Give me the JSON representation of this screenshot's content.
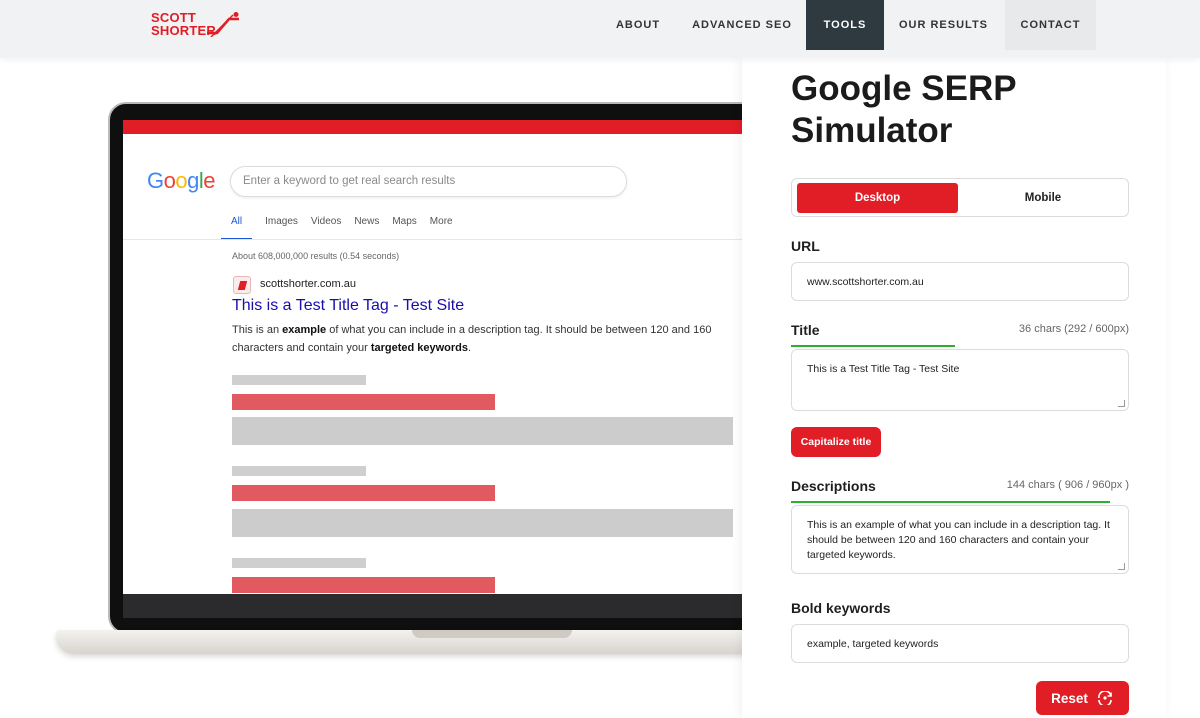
{
  "brand": {
    "line1": "SCOTT",
    "line2": "SHORTER",
    "color": "#e11d26"
  },
  "nav": [
    {
      "label": "ABOUT"
    },
    {
      "label": "ADVANCED SEO"
    },
    {
      "label": "TOOLS",
      "active": true
    },
    {
      "label": "OUR RESULTS"
    },
    {
      "label": "CONTACT"
    }
  ],
  "preview": {
    "search_placeholder": "Enter a keyword to get real search results",
    "tabs": [
      "All",
      "Images",
      "Videos",
      "News",
      "Maps",
      "More"
    ],
    "active_tab": "All",
    "stats": "About 608,000,000 results (0.54 seconds)",
    "site": "scottshorter.com.au",
    "title": "This is a Test Title Tag - Test Site",
    "description_parts": {
      "p1": "This is an ",
      "b1": "example",
      "p2": " of what you can include in a description tag. It should be between 120 and 160 characters and contain your ",
      "b2": "targeted keywords",
      "p3": "."
    }
  },
  "panel": {
    "title_line1": "Google SERP",
    "title_line2": "Simulator",
    "toggle": {
      "desktop": "Desktop",
      "mobile": "Mobile",
      "selected": "Desktop"
    },
    "url": {
      "label": "URL",
      "value": "www.scottshorter.com.au"
    },
    "title": {
      "label": "Title",
      "meta": "36 chars (292 / 600px)",
      "value": "This is a Test Title Tag - Test Site",
      "fill": 0.49
    },
    "capitalize_label": "Capitalize title",
    "descriptions": {
      "label": "Descriptions",
      "meta": "144 chars ( 906 / 960px )",
      "value": "This is an example of what you can include in a description tag. It should be between 120 and 160 characters and contain your targeted keywords.",
      "fill": 0.94
    },
    "bold_keywords": {
      "label": "Bold keywords",
      "value": "example, targeted keywords"
    },
    "reset_label": "Reset"
  },
  "colors": {
    "accent": "#e11d26",
    "progress": "#2fae2f",
    "nav_active_bg": "#2e3a40",
    "link_blue": "#1a0dab"
  },
  "icons": [
    "escalator-logo-icon",
    "reset-icon"
  ]
}
